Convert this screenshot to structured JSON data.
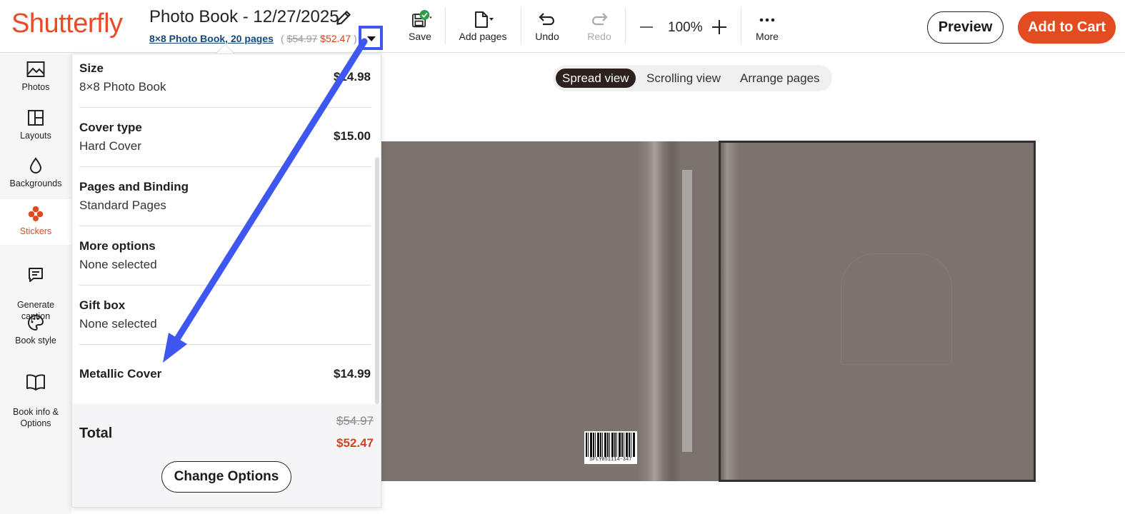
{
  "header": {
    "logo": "Shutterfly",
    "doc_title": "Photo Book - 12/27/2025",
    "book_link": "8×8 Photo Book, 20 pages",
    "price_open": "(",
    "price_old": "$54.97",
    "price_new": "$52.47",
    "price_close": ")"
  },
  "toolbar": {
    "save": "Save",
    "add_pages": "Add pages",
    "undo": "Undo",
    "redo": "Redo",
    "zoom": "100%",
    "more": "More",
    "preview": "Preview",
    "add_to_cart": "Add to Cart"
  },
  "sidebar": {
    "items": [
      {
        "label": "Photos",
        "icon": "image-icon"
      },
      {
        "label": "Layouts",
        "icon": "layout-icon"
      },
      {
        "label": "Backgrounds",
        "icon": "droplet-icon"
      },
      {
        "label": "Stickers",
        "icon": "clover-icon"
      },
      {
        "label": "Generate\ncaption",
        "icon": "caption-icon"
      },
      {
        "label": "Book style",
        "icon": "palette-icon"
      },
      {
        "label": "Book info &\nOptions",
        "icon": "book-icon"
      }
    ],
    "active": "Stickers"
  },
  "view_tabs": [
    "Spread view",
    "Scrolling view",
    "Arrange pages"
  ],
  "active_view": "Spread view",
  "book": {
    "barcode_text": "SFLY051114-347"
  },
  "price_panel": {
    "rows": [
      {
        "title": "Size",
        "value": "8×8 Photo Book",
        "price": "$14.98"
      },
      {
        "title": "Cover type",
        "value": "Hard Cover",
        "price": "$15.00"
      },
      {
        "title": "Pages and Binding",
        "value": "Standard Pages",
        "price": ""
      },
      {
        "title": "More options",
        "value": "None selected",
        "price": ""
      },
      {
        "title": "Gift box",
        "value": "None selected",
        "price": ""
      },
      {
        "title": "Metallic Cover",
        "value": "",
        "price": "$14.99"
      }
    ],
    "total_label": "Total",
    "total_old": "$54.97",
    "total_new": "$52.47",
    "change_button": "Change Options"
  },
  "colors": {
    "brand": "#ea4b27",
    "cart": "#e34c20",
    "sale_price": "#d5401d",
    "annotation": "#3e57f0"
  }
}
